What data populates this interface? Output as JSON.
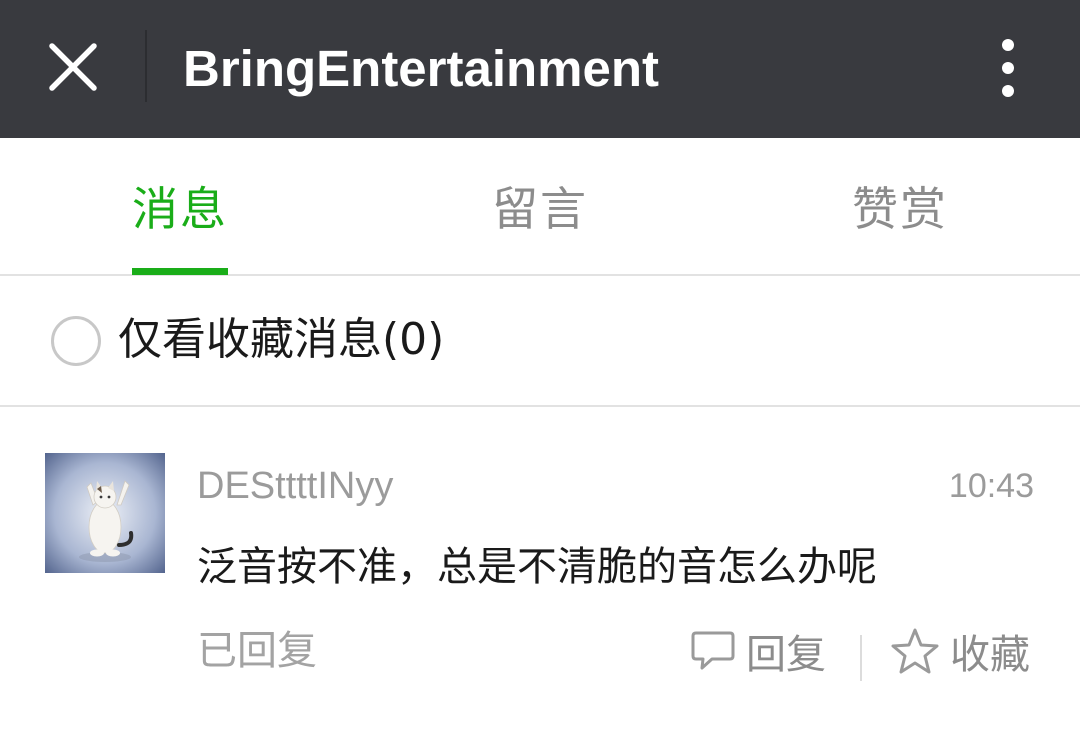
{
  "header": {
    "title": "BringEntertainment",
    "close_icon": "close-icon",
    "more_icon": "more-vertical-icon",
    "background": "#393a3f"
  },
  "tabs": [
    {
      "label": "消息",
      "active": true
    },
    {
      "label": "留言",
      "active": false
    },
    {
      "label": "赞赏",
      "active": false
    }
  ],
  "accent_color": "#1aad19",
  "filter": {
    "label": "仅看收藏消息(0)",
    "checked": false
  },
  "messages": [
    {
      "user": "DESttttINyy",
      "time": "10:43",
      "content": "泛音按不准，总是不清脆的音怎么办呢",
      "status": "已回复",
      "reply_label": "回复",
      "favorite_label": "收藏",
      "avatar": "cat-avatar"
    }
  ]
}
